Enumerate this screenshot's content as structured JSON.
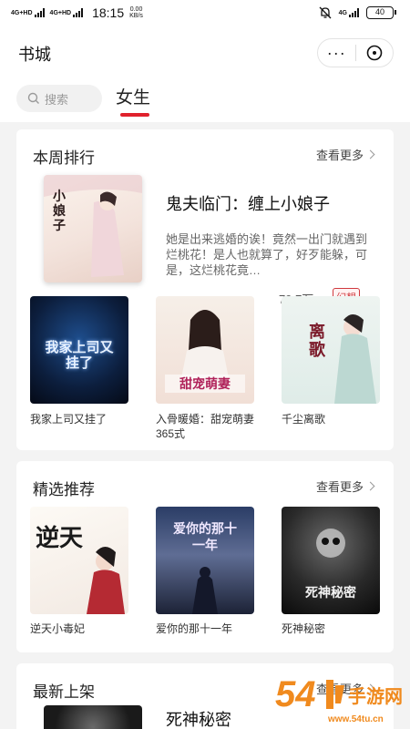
{
  "status_bar": {
    "signal_1": "4G+HD",
    "signal_2": "4G+HD",
    "time": "18:15",
    "speed_value": "0.00",
    "speed_unit": "KB/s",
    "network": "4G",
    "battery": "40"
  },
  "app_bar": {
    "title": "书城",
    "more_label": "···"
  },
  "tabs": {
    "search_placeholder": "搜索",
    "active_tab": "女生"
  },
  "sections": {
    "weekly": {
      "title": "本周排行",
      "more": "查看更多",
      "featured": {
        "title": "鬼夫临门：缠上小娘子",
        "description": "她是出来逃婚的诶！竟然一出门就遇到烂桃花！是人也就算了，好歹能躲，可是，这烂桃花竟…",
        "count": "79.7万",
        "tag": "幻想",
        "cover_text": "小娘子"
      },
      "books": [
        {
          "name": "我家上司又挂了",
          "cover_text": "我家上司又挂了"
        },
        {
          "name": "入骨暖婚：甜宠萌妻365式",
          "cover_text": "甜宠萌妻"
        },
        {
          "name": "千尘离歌",
          "cover_text": "离歌"
        }
      ]
    },
    "picks": {
      "title": "精选推荐",
      "more": "查看更多",
      "books": [
        {
          "name": "逆天小毒妃",
          "cover_text": "逆天"
        },
        {
          "name": "爱你的那十一年",
          "cover_text": "爱你的那十一年"
        },
        {
          "name": "死神秘密",
          "cover_text": "死神秘密"
        }
      ]
    },
    "latest": {
      "title": "最新上架",
      "more": "查看更多",
      "featured_title": "死神秘密"
    }
  },
  "watermark": {
    "number": "54",
    "text": "手游网",
    "url": "www.54tu.cn"
  }
}
